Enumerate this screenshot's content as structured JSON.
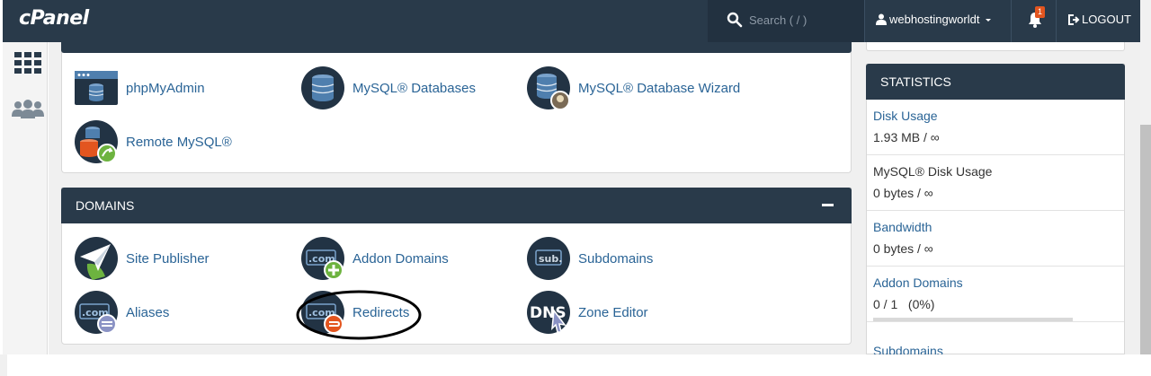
{
  "topbar": {
    "logo": "cPanel",
    "search_placeholder": "Search ( / )",
    "username": "webhostingworldt",
    "notification_count": "1",
    "logout_label": "LOGOUT"
  },
  "databases": {
    "items": [
      {
        "label": "phpMyAdmin",
        "icon": "phpmyadmin-icon"
      },
      {
        "label": "MySQL® Databases",
        "icon": "mysql-databases-icon"
      },
      {
        "label": "MySQL® Database Wizard",
        "icon": "mysql-wizard-icon"
      },
      {
        "label": "Remote MySQL®",
        "icon": "remote-mysql-icon"
      }
    ]
  },
  "domains": {
    "title": "DOMAINS",
    "items": [
      {
        "label": "Site Publisher",
        "icon": "site-publisher-icon"
      },
      {
        "label": "Addon Domains",
        "icon": "addon-domains-icon"
      },
      {
        "label": "Subdomains",
        "icon": "subdomains-icon"
      },
      {
        "label": "Aliases",
        "icon": "aliases-icon"
      },
      {
        "label": "Redirects",
        "icon": "redirects-icon"
      },
      {
        "label": "Zone Editor",
        "icon": "zone-editor-icon"
      }
    ],
    "icon_text": {
      "com": ".com",
      "sub": "sub.",
      "dns": "DNS"
    }
  },
  "statistics": {
    "title": "STATISTICS",
    "rows": [
      {
        "label": "Disk Usage",
        "value": "1.93 MB / ∞"
      },
      {
        "label": "MySQL® Disk Usage",
        "value": "0 bytes / ∞"
      },
      {
        "label": "Bandwidth",
        "value": "0 bytes / ∞"
      },
      {
        "label": "Addon Domains",
        "value": "0 / 1   (0%)",
        "progress": 0
      },
      {
        "label": "Subdomains",
        "value": ""
      }
    ]
  },
  "colors": {
    "header_bg": "#293a4a",
    "link": "#2a6496",
    "accent_orange": "#e3551f"
  }
}
